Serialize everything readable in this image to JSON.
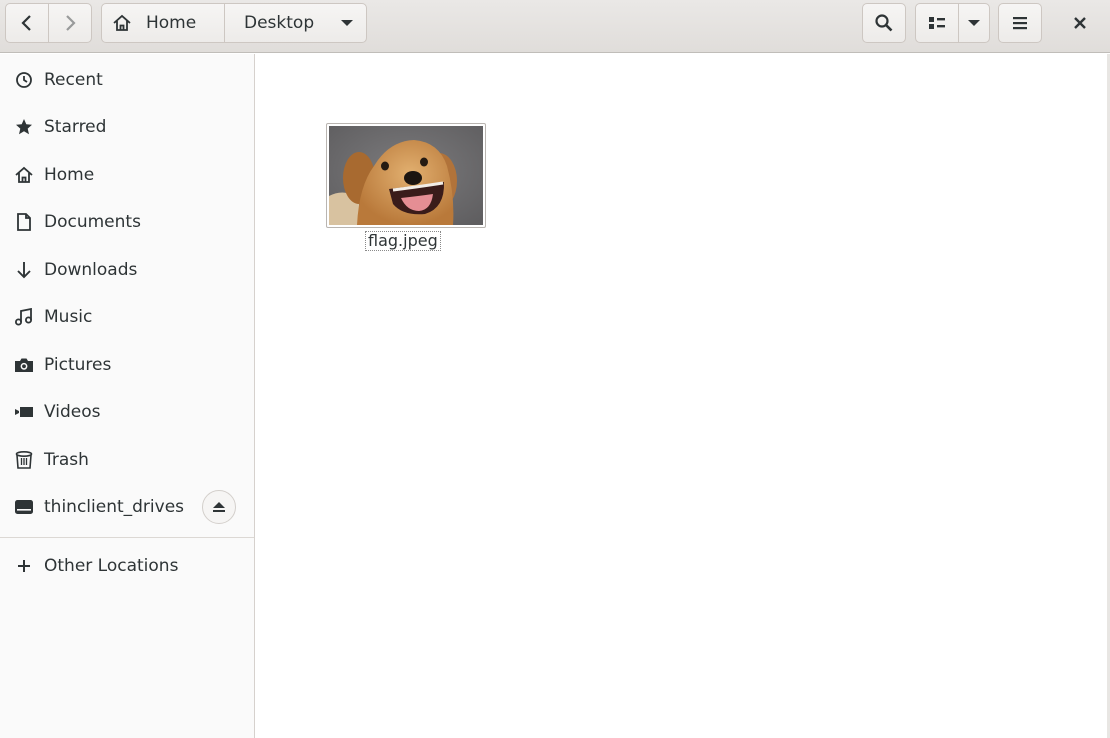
{
  "header": {
    "breadcrumbs": [
      "Home",
      "Desktop"
    ],
    "icons": {
      "back": "chevron-left-icon",
      "forward": "chevron-right-icon",
      "home": "home-icon",
      "search": "search-icon",
      "view": "list-view-icon",
      "view_dropdown": "caret-down-icon",
      "menu": "hamburger-menu-icon",
      "close": "close-icon"
    }
  },
  "sidebar": {
    "items": [
      {
        "label": "Recent",
        "icon": "clock-icon"
      },
      {
        "label": "Starred",
        "icon": "star-icon"
      },
      {
        "label": "Home",
        "icon": "home-icon"
      },
      {
        "label": "Documents",
        "icon": "document-icon"
      },
      {
        "label": "Downloads",
        "icon": "download-icon"
      },
      {
        "label": "Music",
        "icon": "music-icon"
      },
      {
        "label": "Pictures",
        "icon": "camera-icon"
      },
      {
        "label": "Videos",
        "icon": "video-icon"
      },
      {
        "label": "Trash",
        "icon": "trash-icon"
      },
      {
        "label": "thinclient_drives",
        "icon": "drive-icon"
      }
    ],
    "other_locations": {
      "label": "Other Locations",
      "icon": "plus-icon"
    }
  },
  "files": [
    {
      "name": "flag.jpeg",
      "thumbnail": "dog-photo"
    }
  ],
  "colors": {
    "header_bg": "#e0ddda",
    "sidebar_bg": "#fafafa",
    "text": "#2e3436"
  }
}
